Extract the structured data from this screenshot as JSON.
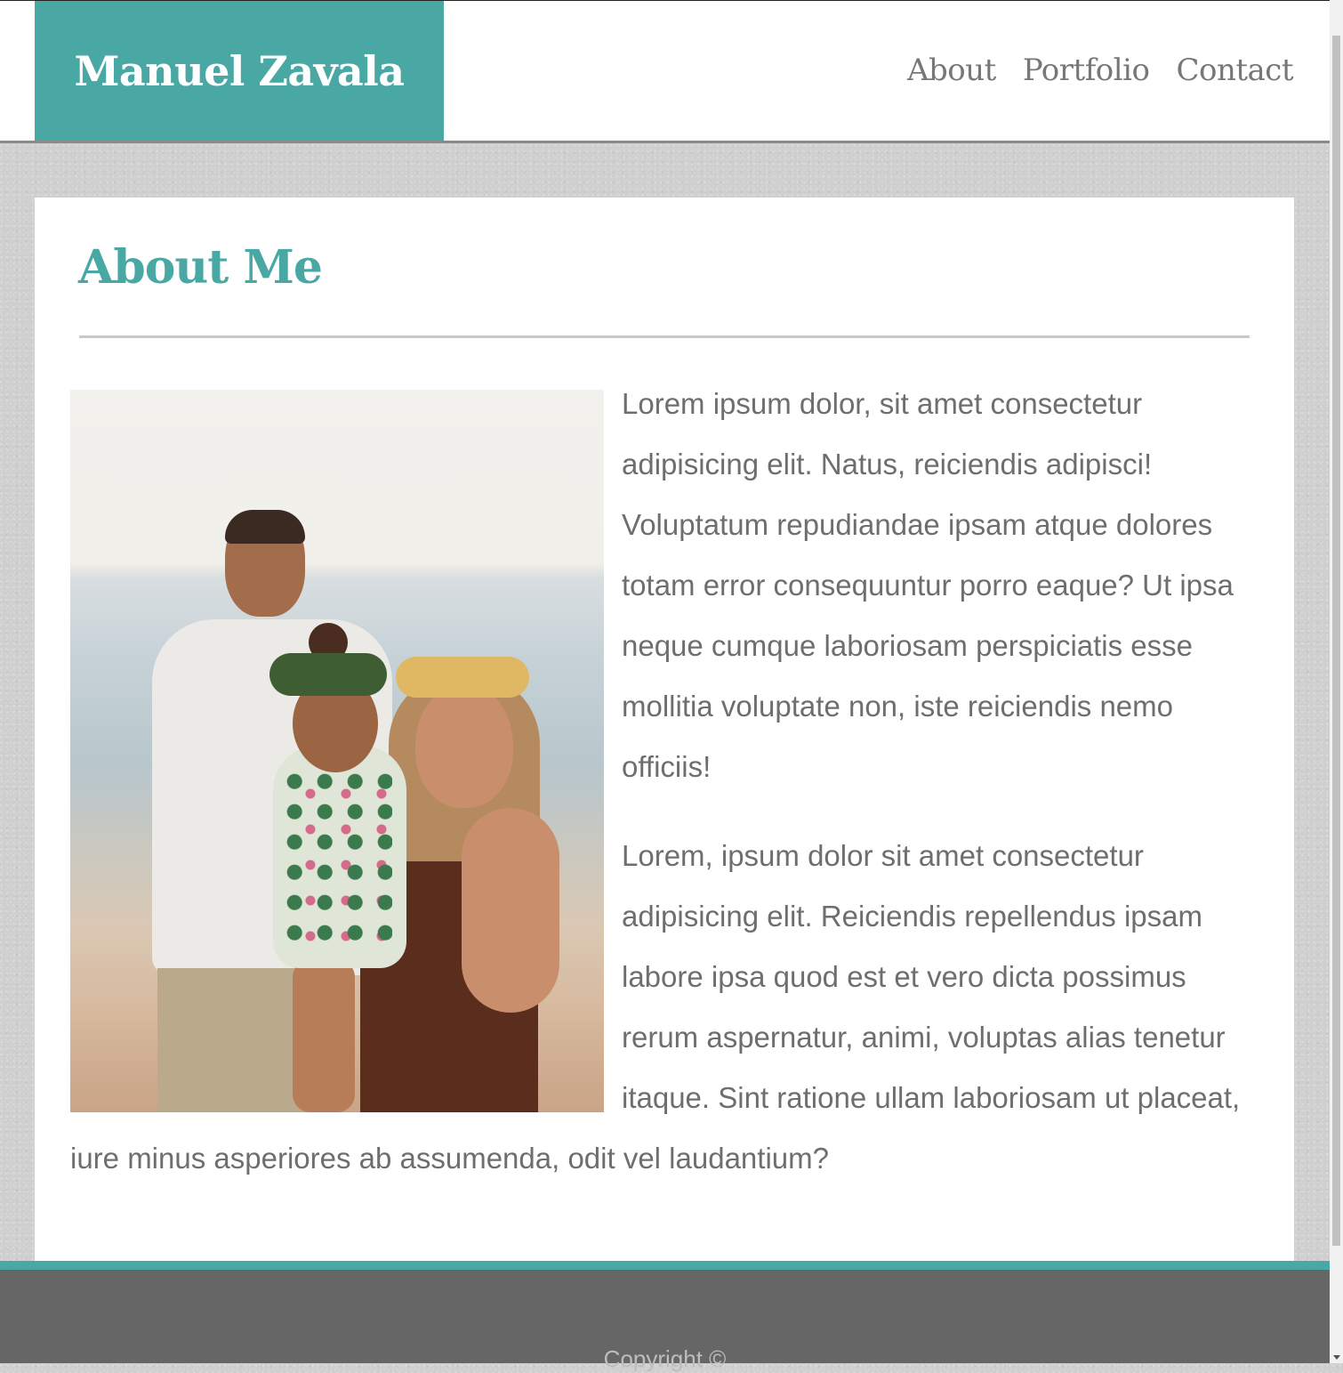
{
  "header": {
    "brand_name": "Manuel Zavala",
    "nav": [
      {
        "label": "About"
      },
      {
        "label": "Portfolio"
      },
      {
        "label": "Contact"
      }
    ]
  },
  "main": {
    "title": "About Me",
    "photo_alt": "Family photo on the beach",
    "paragraphs": [
      "Lorem ipsum dolor, sit amet consectetur adipisicing elit. Natus, reiciendis adipisci! Voluptatum repudiandae ipsam atque dolores totam error consequuntur porro eaque? Ut ipsa neque cumque laboriosam perspiciatis esse mollitia voluptate non, iste reiciendis nemo officiis!",
      "Lorem, ipsum dolor sit amet consectetur adipisicing elit. Reiciendis repellendus ipsam labore ipsa quod est et vero dicta possimus rerum aspernatur, animi, voluptas alias tenetur itaque. Sint ratione ullam laboriosam ut placeat, iure minus asperiores ab assumenda, odit vel laudantium?"
    ]
  },
  "footer": {
    "copyright": "Copyright ©"
  },
  "colors": {
    "accent": "#4aa8a4",
    "footer_bg": "#666666",
    "nav_text": "#777777",
    "body_text": "#6e6e6e"
  }
}
